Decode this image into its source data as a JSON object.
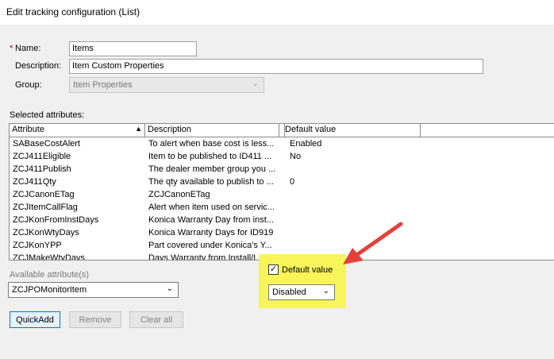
{
  "window": {
    "title": "Edit tracking configuration (List)"
  },
  "form": {
    "name_required_marker": "*",
    "name_label": "Name:",
    "name_value": "Items",
    "description_label": "Description:",
    "description_value": "Item Custom Properties",
    "group_label": "Group:",
    "group_value": "Item Properties"
  },
  "selected": {
    "label": "Selected attributes:",
    "columns": [
      "Attribute",
      "Description",
      "Default value"
    ],
    "rows": [
      {
        "attr": "SABaseCostAlert",
        "desc": "To alert when base cost is less...",
        "def": "Enabled"
      },
      {
        "attr": "ZCJ411Eligible",
        "desc": "Item to be published to ID411 ...",
        "def": "No"
      },
      {
        "attr": "ZCJ411Publish",
        "desc": "The dealer member group you ...",
        "def": ""
      },
      {
        "attr": "ZCJ411Qty",
        "desc": "The qty available to publish to ...",
        "def": "0"
      },
      {
        "attr": "ZCJCanonETag",
        "desc": "ZCJCanonETag",
        "def": ""
      },
      {
        "attr": "ZCJItemCallFlag",
        "desc": "Alert when item used on servic...",
        "def": ""
      },
      {
        "attr": "ZCJKonFromInstDays",
        "desc": "Konica Warranty Day from inst...",
        "def": ""
      },
      {
        "attr": "ZCJKonWtyDays",
        "desc": "Konica Warranty Days for ID919",
        "def": ""
      },
      {
        "attr": "ZCJKonYPP",
        "desc": "Part covered under Konica's Y...",
        "def": ""
      },
      {
        "attr": "ZCJMakeWtyDays",
        "desc": "Days Warranty from Install/La...",
        "def": ""
      }
    ]
  },
  "available": {
    "label": "Available attribute(s)",
    "value": "ZCJPOMonitorItem"
  },
  "default_panel": {
    "checkbox_label": "Default value",
    "checked_mark": "✓",
    "select_value": "Disabled",
    "highlight_color": "#f7f55a"
  },
  "buttons": {
    "quickadd": "QuickAdd",
    "remove": "Remove",
    "clear_all": "Clear all"
  },
  "annotation": {
    "arrow_color": "#e5403a"
  }
}
